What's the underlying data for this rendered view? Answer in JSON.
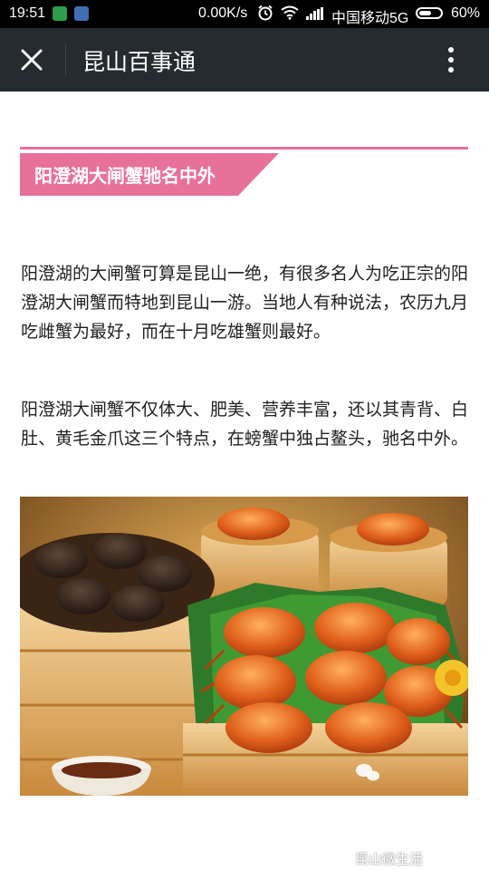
{
  "status_bar": {
    "time": "19:51",
    "network_speed": "0.00K/s",
    "carrier": "中国移动5G",
    "battery": "60%",
    "battery_level": 0.6
  },
  "nav": {
    "title": "昆山百事通"
  },
  "article": {
    "heading": "阳澄湖大闸蟹驰名中外",
    "paragraphs": [
      "阳澄湖的大闸蟹可算是昆山一绝，有很多名人为吃正宗的阳澄湖大闸蟹而特地到昆山一游。当地人有种说法，农历九月吃雌蟹为最好，而在十月吃雄蟹则最好。",
      "阳澄湖大闸蟹不仅体大、肥美、营养丰富，还以其青背、白肚、黄毛金爪这三个特点，在螃蟹中独占鳌头，驰名中外。"
    ],
    "image_watermark": "昆山微生活"
  },
  "colors": {
    "accent": "#e8719a",
    "nav_bg": "#262b2f"
  }
}
